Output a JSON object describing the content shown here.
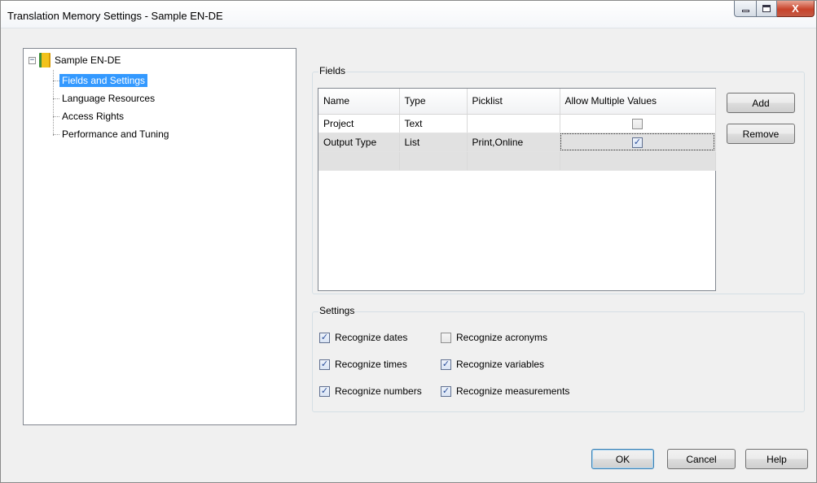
{
  "window": {
    "title": "Translation Memory Settings - Sample EN-DE",
    "close_label": "X"
  },
  "tree": {
    "root": {
      "label": "Sample EN-DE",
      "expander": "−"
    },
    "items": [
      {
        "label": "Fields and Settings",
        "selected": true
      },
      {
        "label": "Language Resources",
        "selected": false
      },
      {
        "label": "Access Rights",
        "selected": false
      },
      {
        "label": "Performance and Tuning",
        "selected": false
      }
    ]
  },
  "fields": {
    "caption": "Fields",
    "columns": [
      "Name",
      "Type",
      "Picklist",
      "Allow Multiple Values"
    ],
    "rows": [
      {
        "name": "Project",
        "type": "Text",
        "picklist": "",
        "allow_multiple": false
      },
      {
        "name": "Output Type",
        "type": "List",
        "picklist": "Print,Online",
        "allow_multiple": true
      }
    ],
    "add_label": "Add",
    "remove_label": "Remove"
  },
  "settings": {
    "caption": "Settings",
    "options": [
      {
        "label": "Recognize dates",
        "checked": true
      },
      {
        "label": "Recognize acronyms",
        "checked": false
      },
      {
        "label": "Recognize times",
        "checked": true
      },
      {
        "label": "Recognize variables",
        "checked": true
      },
      {
        "label": "Recognize numbers",
        "checked": true
      },
      {
        "label": "Recognize measurements",
        "checked": true
      }
    ]
  },
  "footer": {
    "ok_label": "OK",
    "cancel_label": "Cancel",
    "help_label": "Help"
  },
  "check_glyph": "✓"
}
